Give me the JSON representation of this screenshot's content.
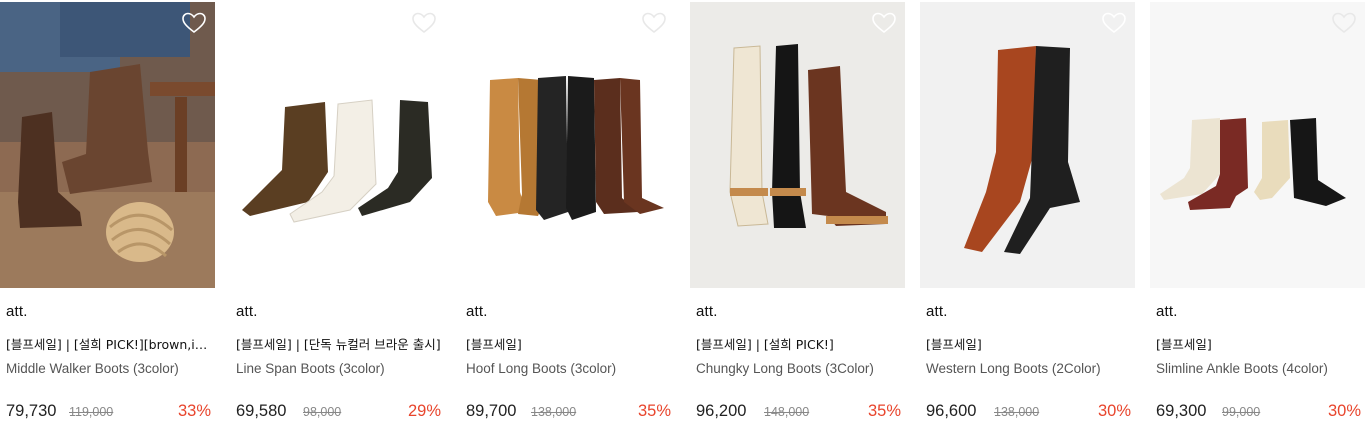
{
  "products": [
    {
      "brand": "att.",
      "tag": "[블프세일] | [설희 PICK!][brown,ivory]",
      "name": "Middle Walker Boots (3color)",
      "price": "79,730",
      "original_price": "119,000",
      "discount": "33%",
      "image_icon": "middle-walker-boots-photo"
    },
    {
      "brand": "att.",
      "tag": "[블프세일] | [단독 뉴컬러 브라운 출시]",
      "name": "Line Span Boots (3color)",
      "price": "69,580",
      "original_price": "98,000",
      "discount": "29%",
      "image_icon": "line-span-boots-photo"
    },
    {
      "brand": "att.",
      "tag": "[블프세일]",
      "name": "Hoof Long Boots (3color)",
      "price": "89,700",
      "original_price": "138,000",
      "discount": "35%",
      "image_icon": "hoof-long-boots-photo"
    },
    {
      "brand": "att.",
      "tag": "[블프세일] | [설희 PICK!]",
      "name": "Chungky Long Boots (3Color)",
      "price": "96,200",
      "original_price": "148,000",
      "discount": "35%",
      "image_icon": "chungky-long-boots-photo"
    },
    {
      "brand": "att.",
      "tag": "[블프세일]",
      "name": "Western Long Boots (2Color)",
      "price": "96,600",
      "original_price": "138,000",
      "discount": "30%",
      "image_icon": "western-long-boots-photo"
    },
    {
      "brand": "att.",
      "tag": "[블프세일]",
      "name": "Slimline Ankle Boots (4color)",
      "price": "69,300",
      "original_price": "99,000",
      "discount": "30%",
      "image_icon": "slimline-ankle-boots-photo"
    }
  ],
  "colors": {
    "discount": "#e8452d",
    "text": "#222222",
    "muted": "#888888"
  }
}
